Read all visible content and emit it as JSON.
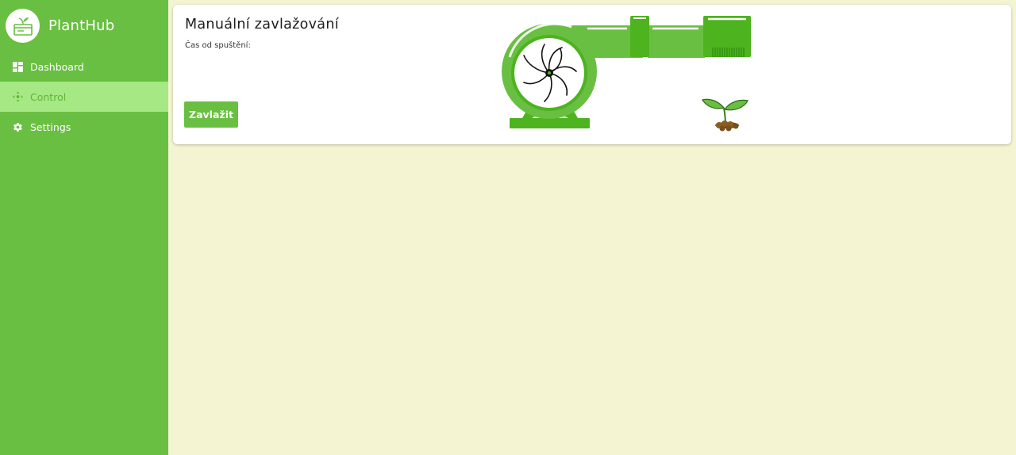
{
  "app": {
    "name": "PlantHub"
  },
  "sidebar": {
    "items": [
      {
        "label": "Dashboard",
        "icon": "dashboard-icon",
        "active": false
      },
      {
        "label": "Control",
        "icon": "control-icon",
        "active": true
      },
      {
        "label": "Settings",
        "icon": "gear-icon",
        "active": false
      }
    ]
  },
  "card": {
    "title": "Manuální zavlažování",
    "subtitle": "Čas od spuštění:",
    "button_label": "Zavlažit"
  },
  "colors": {
    "sidebar": "#69bf41",
    "active_item_bg": "#a6e884",
    "page_bg": "#f4f4d3",
    "pump_dark": "#4db31f",
    "pump_light": "#69bf41"
  }
}
